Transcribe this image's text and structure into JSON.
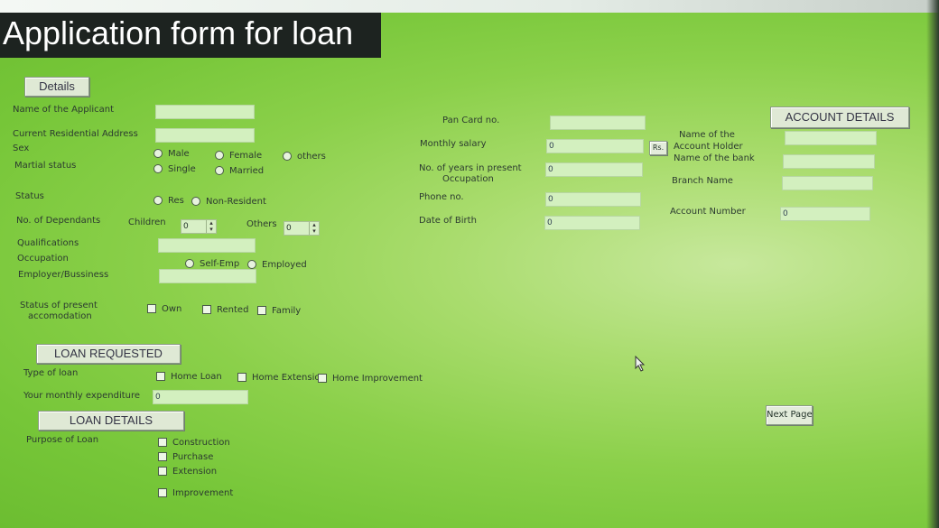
{
  "title": "Application form for loan",
  "details": {
    "header": "Details",
    "name_label": "Name of the Applicant",
    "address_label": "Current Residential Address",
    "sex_label": "Sex",
    "sex_options": [
      "Male",
      "Female",
      "others"
    ],
    "marital_label": "Martial status",
    "marital_options": [
      "Single",
      "Married"
    ],
    "status_label": "Status",
    "status_options": [
      "Res",
      "Non-Resident"
    ],
    "dependants_label": "No. of Dependants",
    "children_label": "Children",
    "children_value": "0",
    "others_label": "Others",
    "others_value": "0",
    "qualifications_label": "Qualifications",
    "occupation_label": "Occupation",
    "occupation_options": [
      "Self-Emp",
      "Employed"
    ],
    "employer_label": "Employer/Bussiness",
    "accom_label_1": "Status of present",
    "accom_label_2": "accomodation",
    "accom_options": [
      "Own",
      "Rented",
      "Family"
    ]
  },
  "middle": {
    "pan_label": "Pan Card no.",
    "salary_label": "Monthly salary",
    "salary_value": "0",
    "rs_label": "Rs.",
    "years_label_1": "No. of years in present",
    "years_label_2": "Occupation",
    "years_value": "0",
    "phone_label": "Phone no.",
    "phone_value": "0",
    "dob_label": "Date of Birth",
    "dob_value": "0"
  },
  "account": {
    "header": "ACCOUNT DETAILS",
    "holder_label_1": "Name of the",
    "holder_label_2": "Account Holder",
    "bank_label": "Name of the bank",
    "branch_label": "Branch Name",
    "acct_number_label": "Account Number",
    "acct_number_value": "0"
  },
  "loan_requested": {
    "header": "LOAN REQUESTED",
    "type_label": "Type of loan",
    "type_options": [
      "Home Loan",
      "Home Extensior",
      "Home Improvement"
    ],
    "expenditure_label": "Your monthly expenditure",
    "expenditure_value": "0"
  },
  "loan_details": {
    "header": "LOAN DETAILS",
    "purpose_label": "Purpose of Loan",
    "purpose_options": [
      "Construction",
      "Purchase",
      "Extension",
      "Improvement"
    ]
  },
  "next_page_label": "Next Page"
}
